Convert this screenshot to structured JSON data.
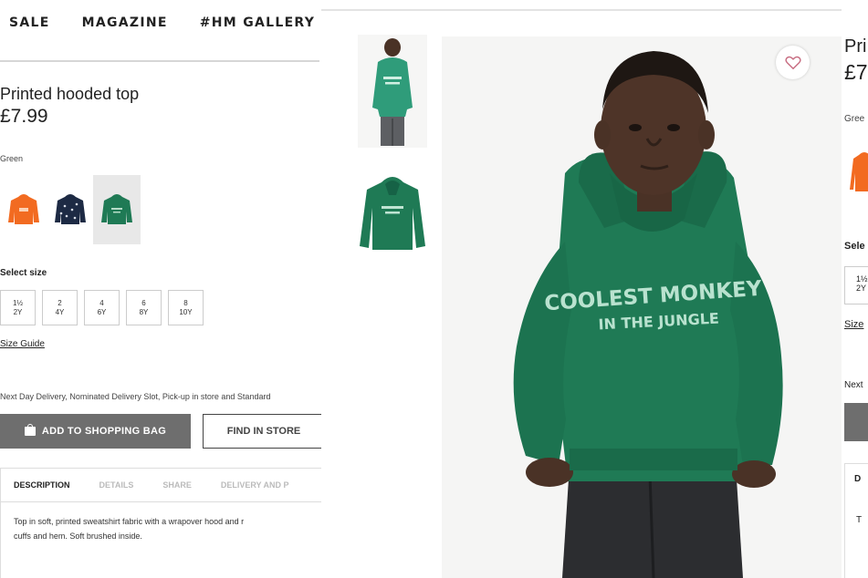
{
  "nav": {
    "items": [
      "SALE",
      "MAGAZINE",
      "#HM GALLERY"
    ]
  },
  "product": {
    "title": "Printed hooded top",
    "price": "£7.99",
    "color_label": "Green",
    "hoodie_print_line1": "COOLEST MONKEY",
    "hoodie_print_line2": "IN THE JUNGLE",
    "swatches": [
      {
        "color": "#f26b21",
        "selected": false
      },
      {
        "color": "#1d2a44",
        "selected": false
      },
      {
        "color": "#1f7a55",
        "selected": true
      }
    ]
  },
  "size": {
    "label": "Select size",
    "options": [
      {
        "top": "1½",
        "bottom": "2Y"
      },
      {
        "top": "2",
        "bottom": "4Y"
      },
      {
        "top": "4",
        "bottom": "6Y"
      },
      {
        "top": "6",
        "bottom": "8Y"
      },
      {
        "top": "8",
        "bottom": "10Y"
      }
    ],
    "guide": "Size Guide"
  },
  "delivery_text": "Next Day Delivery, Nominated Delivery Slot, Pick-up in store and Standard",
  "buttons": {
    "add_to_bag": "ADD TO SHOPPING BAG",
    "find_in_store": "FIND IN STORE"
  },
  "tabs": [
    "DESCRIPTION",
    "DETAILS",
    "SHARE",
    "DELIVERY AND P"
  ],
  "description": {
    "line1": "Top in soft, printed sweatshirt fabric with a wrapover hood and r",
    "line2": "cuffs and hem. Soft brushed inside."
  },
  "right_panel": {
    "title": "Pri",
    "price": "£7",
    "color": "Gree",
    "size_label": "Sele",
    "size_top": "1½",
    "size_bottom": "2Y",
    "size_guide": "Size",
    "next": "Next",
    "tab": "D",
    "desc": "T"
  },
  "colors": {
    "hoodie": "#1f7a55",
    "button_grey": "#6e6e6e",
    "accent_heart": "#c76b80"
  },
  "icons": [
    "shopping-bag-icon",
    "heart-icon"
  ]
}
